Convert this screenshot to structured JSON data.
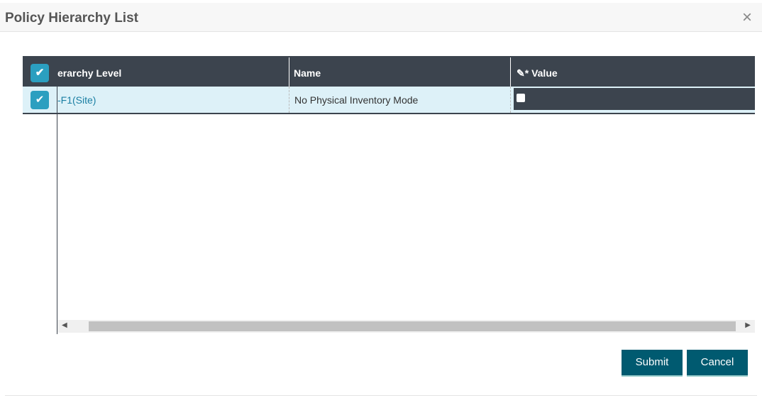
{
  "dialog": {
    "title": "Policy Hierarchy List",
    "close_icon": "×"
  },
  "table": {
    "columns": [
      "erarchy Level",
      "Name",
      "Value"
    ],
    "rows": [
      {
        "hierarchy_level": "-F1(Site)",
        "name": "No Physical Inventory Mode",
        "value": false
      }
    ]
  },
  "buttons": {
    "submit": "Submit",
    "cancel": "Cancel"
  }
}
